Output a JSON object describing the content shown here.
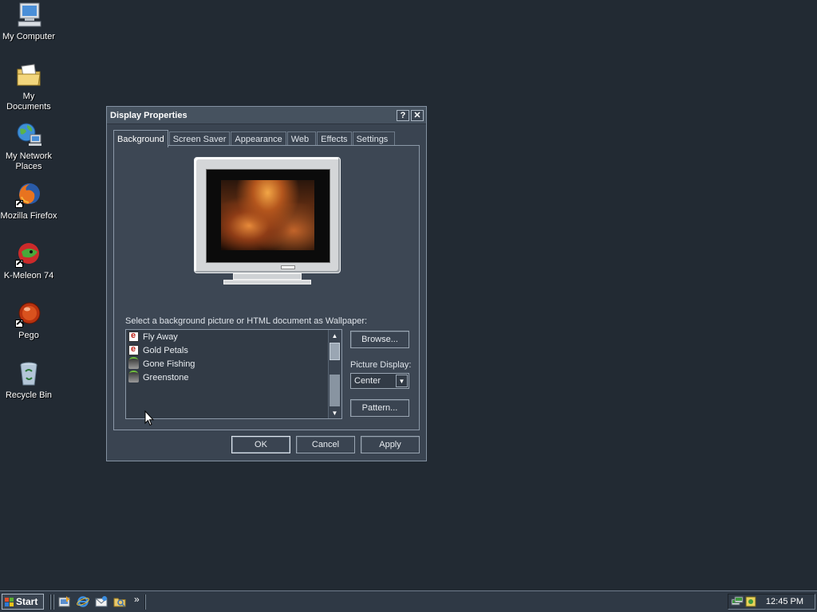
{
  "desktop": {
    "icons": [
      {
        "label": "My Computer",
        "icon": "my-computer-icon"
      },
      {
        "label": "My Documents",
        "icon": "my-documents-icon"
      },
      {
        "label": "My Network Places",
        "icon": "network-places-icon"
      },
      {
        "label": "Mozilla Firefox",
        "icon": "firefox-icon"
      },
      {
        "label": "K-Meleon 74",
        "icon": "k-meleon-icon"
      },
      {
        "label": "Pego",
        "icon": "pego-icon"
      },
      {
        "label": "Recycle Bin",
        "icon": "recycle-bin-icon"
      }
    ]
  },
  "dialog": {
    "title": "Display Properties",
    "help_glyph": "?",
    "close_glyph": "✕",
    "tabs": [
      "Background",
      "Screen Saver",
      "Appearance",
      "Web",
      "Effects",
      "Settings"
    ],
    "active_tab": "Background",
    "wallpaper_label": "Select a background picture or HTML document as Wallpaper:",
    "wallpapers": [
      {
        "label": "Fly Away",
        "icon": "html-document-icon"
      },
      {
        "label": "Gold Petals",
        "icon": "html-document-icon"
      },
      {
        "label": "Gone Fishing",
        "icon": "bitmap-image-icon"
      },
      {
        "label": "Greenstone",
        "icon": "bitmap-image-icon"
      }
    ],
    "browse_label": "Browse...",
    "picture_display_label": "Picture Display:",
    "picture_display_value": "Center",
    "pattern_label": "Pattern...",
    "ok_label": "OK",
    "cancel_label": "Cancel",
    "apply_label": "Apply"
  },
  "taskbar": {
    "start_label": "Start",
    "quick_launch": [
      "show-desktop-icon",
      "internet-explorer-icon",
      "outlook-express-icon",
      "windows-explorer-icon"
    ],
    "chevron": "»",
    "clock": "12:45 PM"
  }
}
